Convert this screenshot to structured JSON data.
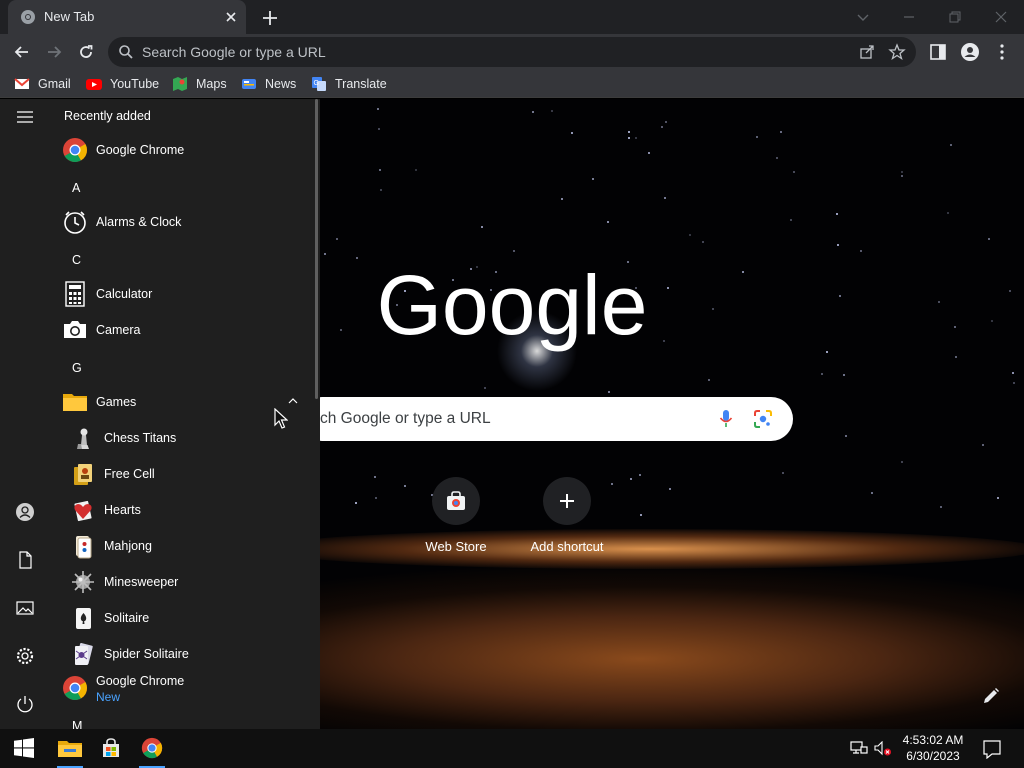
{
  "browser": {
    "tab_title": "New Tab",
    "omnibox_placeholder": "Search Google or type a URL"
  },
  "bookmarks": [
    {
      "label": "Gmail",
      "icon": "gmail-icon"
    },
    {
      "label": "YouTube",
      "icon": "youtube-icon"
    },
    {
      "label": "Maps",
      "icon": "maps-icon"
    },
    {
      "label": "News",
      "icon": "news-icon"
    },
    {
      "label": "Translate",
      "icon": "translate-icon"
    }
  ],
  "start_menu": {
    "header": "Recently added",
    "recent": [
      {
        "label": "Google Chrome",
        "icon": "chrome-icon"
      }
    ],
    "groups": [
      {
        "letter": "A",
        "items": [
          {
            "label": "Alarms & Clock",
            "icon": "alarm-clock-icon"
          }
        ]
      },
      {
        "letter": "C",
        "items": [
          {
            "label": "Calculator",
            "icon": "calculator-icon"
          },
          {
            "label": "Camera",
            "icon": "camera-icon"
          }
        ]
      },
      {
        "letter": "G",
        "items": [
          {
            "label": "Games",
            "icon": "folder-icon"
          }
        ]
      }
    ],
    "games": [
      {
        "label": "Chess Titans",
        "icon": "chess-icon"
      },
      {
        "label": "Free Cell",
        "icon": "freecell-icon"
      },
      {
        "label": "Hearts",
        "icon": "hearts-icon"
      },
      {
        "label": "Mahjong",
        "icon": "mahjong-icon"
      },
      {
        "label": "Minesweeper",
        "icon": "minesweeper-icon"
      },
      {
        "label": "Solitaire",
        "icon": "solitaire-icon"
      },
      {
        "label": "Spider Solitaire",
        "icon": "spider-solitaire-icon"
      }
    ],
    "after_games": {
      "label": "Google Chrome",
      "tag": "New",
      "icon": "chrome-icon"
    },
    "next_letter": "M"
  },
  "ntp": {
    "logo_text": "Google",
    "search_placeholder": "ch Google or type a URL",
    "shortcuts": [
      {
        "label": "Web Store",
        "icon": "web-store-icon"
      },
      {
        "label": "Add shortcut",
        "icon": "plus-icon"
      }
    ]
  },
  "taskbar": {
    "time": "4:53:02 AM",
    "date": "6/30/2023"
  },
  "colors": {
    "accent": "#4aa3ff",
    "menu_bg": "#1f1f1f",
    "browser_frame": "#202124",
    "toolbar": "#35363a"
  }
}
